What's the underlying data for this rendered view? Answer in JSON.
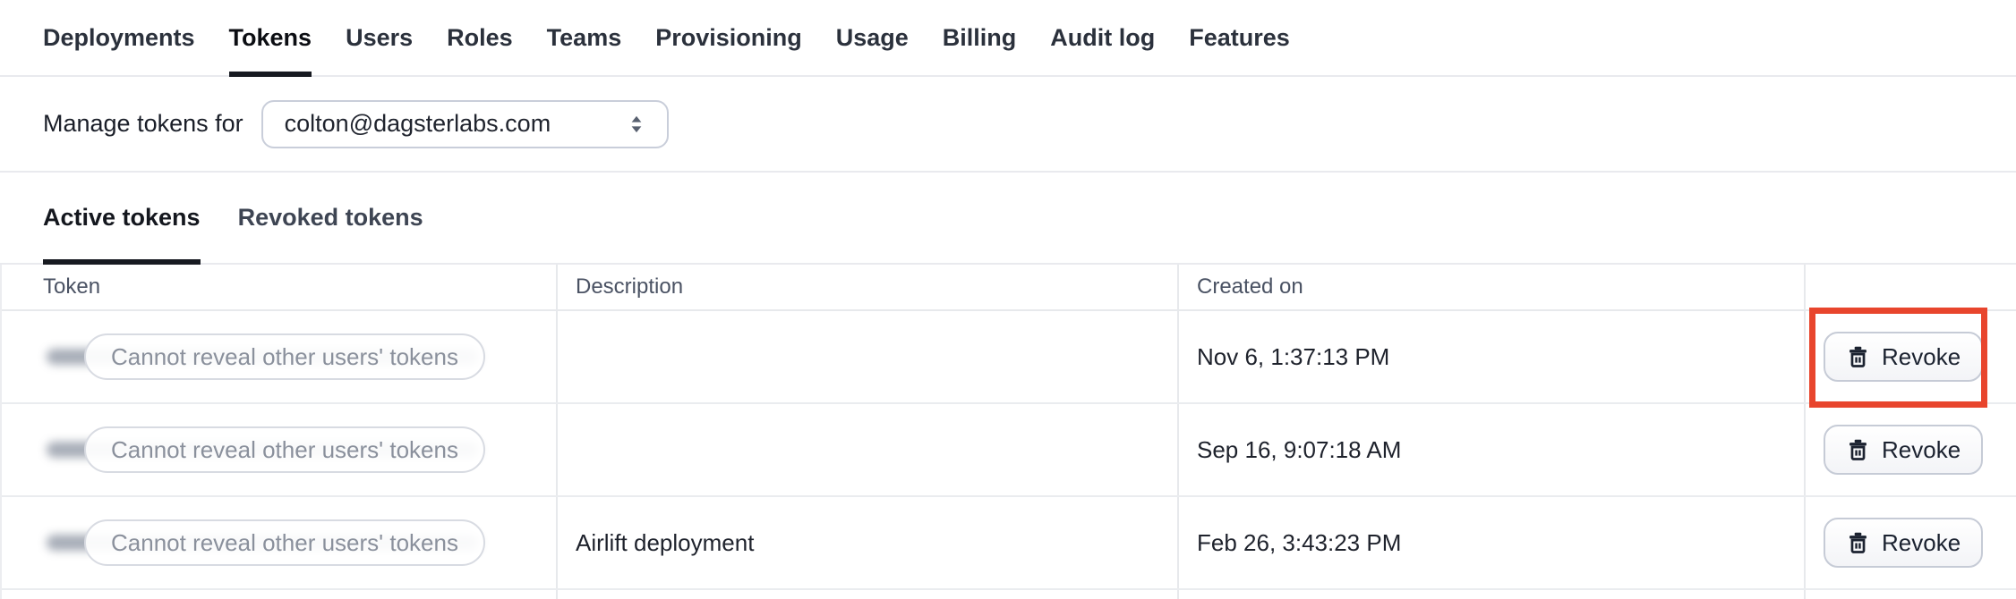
{
  "nav": {
    "tabs": [
      "Deployments",
      "Tokens",
      "Users",
      "Roles",
      "Teams",
      "Provisioning",
      "Usage",
      "Billing",
      "Audit log",
      "Features"
    ],
    "active_tab": "Tokens"
  },
  "manage_tokens": {
    "label": "Manage tokens for",
    "selected_user": "colton@dagsterlabs.com",
    "select_icon": "double-caret-vertical-icon"
  },
  "token_tabs": {
    "tabs": [
      "Active tokens",
      "Revoked tokens"
    ],
    "active_tab": "Active tokens"
  },
  "table": {
    "columns": {
      "token": "Token",
      "description": "Description",
      "created_on": "Created on",
      "actions": ""
    },
    "rows": [
      {
        "token_placeholder": "Cannot reveal other users' tokens",
        "description": "",
        "created_on": "Nov 6, 1:37:13 PM",
        "action_label": "Revoke",
        "highlighted": true
      },
      {
        "token_placeholder": "Cannot reveal other users' tokens",
        "description": "",
        "created_on": "Sep 16, 9:07:18 AM",
        "action_label": "Revoke",
        "highlighted": false
      },
      {
        "token_placeholder": "Cannot reveal other users' tokens",
        "description": "Airlift deployment",
        "created_on": "Feb 26, 3:43:23 PM",
        "action_label": "Revoke",
        "highlighted": false
      }
    ]
  },
  "annotation": {
    "type": "highlight-box",
    "color": "#E8452D",
    "target": "revoke-button-row-1"
  },
  "colors": {
    "active_underline": "#171A21",
    "divider": "#E9EAEE",
    "header_text": "#4A5263",
    "body_text": "#1E222C",
    "muted_text": "#8A909C",
    "redacted_bar": "#99A0AC"
  }
}
